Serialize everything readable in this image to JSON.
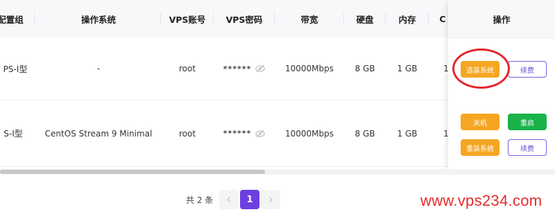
{
  "table": {
    "headers": {
      "plan": "配置组",
      "os": "操作系统",
      "vps_account": "VPS账号",
      "vps_password": "VPS密码",
      "bandwidth": "带宽",
      "disk": "硬盘",
      "memory": "内存",
      "cpu": "C",
      "operations": "操作"
    },
    "rows": [
      {
        "plan": "PS-Ⅰ型",
        "os": "-",
        "account": "root",
        "password": "******",
        "bandwidth": "10000Mbps",
        "disk": "8 GB",
        "memory": "1 GB",
        "cpu": "1",
        "actions": {
          "primary": "选装系统",
          "secondary": "续费"
        }
      },
      {
        "plan": "S-Ⅰ型",
        "os": "CentOS Stream 9 Minimal",
        "account": "root",
        "password": "******",
        "bandwidth": "10000Mbps",
        "disk": "8 GB",
        "memory": "1 GB",
        "cpu": "1",
        "actions": {
          "shutdown": "关机",
          "restart": "重启",
          "reinstall": "重装系统",
          "renew": "续费"
        }
      }
    ]
  },
  "pagination": {
    "total": "共 2 条",
    "current_page": "1",
    "prev_icon": "chevron-left-icon",
    "next_icon": "chevron-right-icon"
  },
  "watermark": "www.vps234.com",
  "colors": {
    "accent": "#6c3fe0",
    "orange": "#f5a623",
    "green": "#19b24b",
    "highlight": "#e5242b"
  }
}
